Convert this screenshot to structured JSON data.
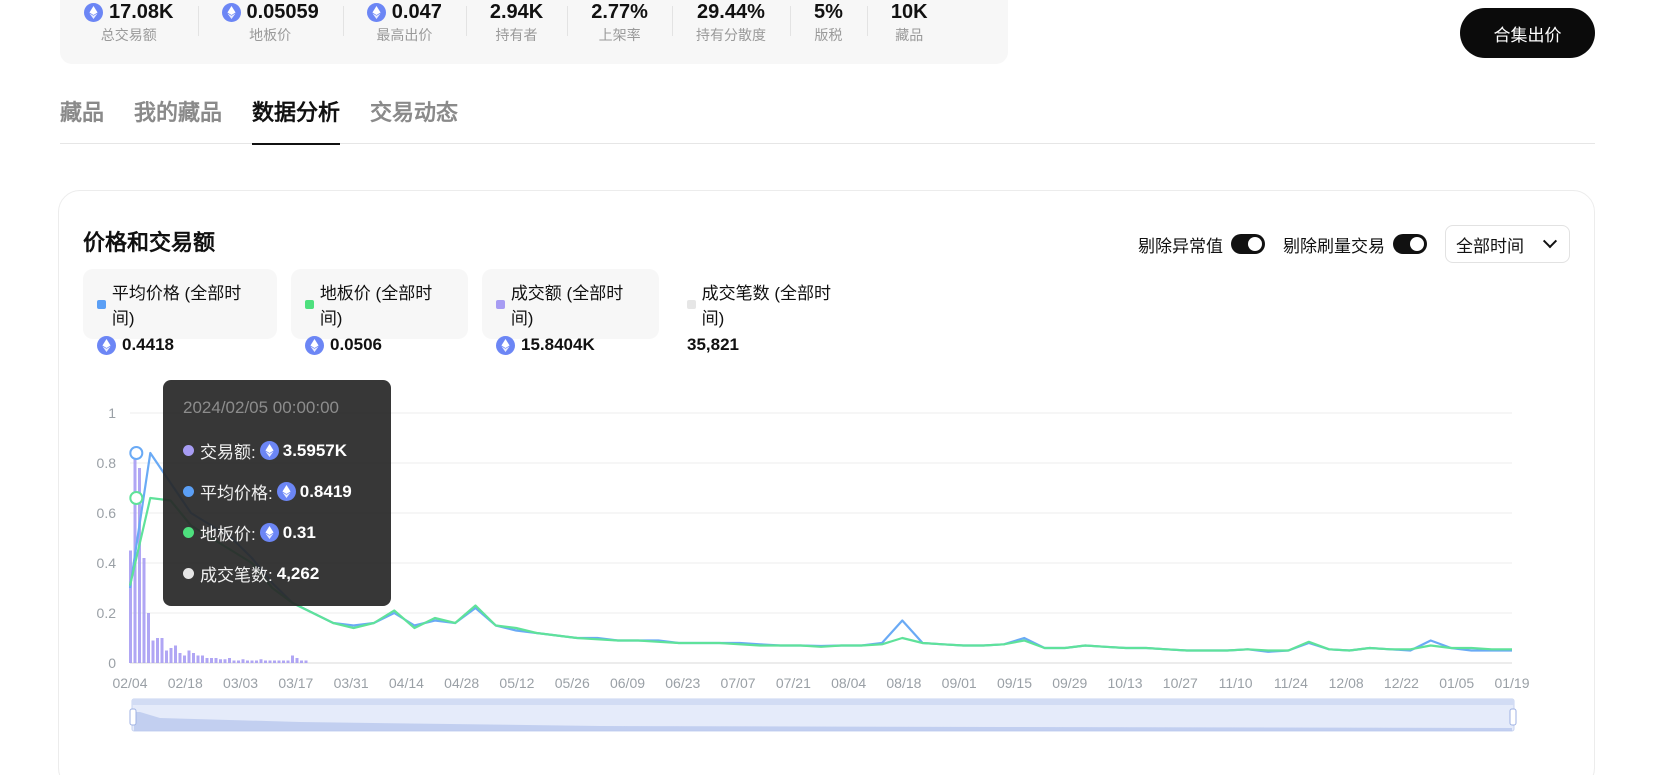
{
  "stats": [
    {
      "value": "17.08K",
      "label": "总交易额",
      "eth": true
    },
    {
      "value": "0.05059",
      "label": "地板价",
      "eth": true
    },
    {
      "value": "0.047",
      "label": "最高出价",
      "eth": true
    },
    {
      "value": "2.94K",
      "label": "持有者",
      "eth": false
    },
    {
      "value": "2.77%",
      "label": "上架率",
      "eth": false
    },
    {
      "value": "29.44%",
      "label": "持有分散度",
      "eth": false
    },
    {
      "value": "5%",
      "label": "版税",
      "eth": false
    },
    {
      "value": "10K",
      "label": "藏品",
      "eth": false
    }
  ],
  "offer_button": "合集出价",
  "tabs": [
    "藏品",
    "我的藏品",
    "数据分析",
    "交易动态"
  ],
  "active_tab": 2,
  "card": {
    "title": "价格和交易额",
    "toggle_outliers": "剔除异常值",
    "toggle_wash": "剔除刷量交易",
    "time_select": "全部时间"
  },
  "legend": [
    {
      "name": "平均价格 (全部时间)",
      "value": "0.4418",
      "color": "#5b9ff5",
      "eth": true
    },
    {
      "name": "地板价 (全部时间)",
      "value": "0.0506",
      "color": "#4ee07e",
      "eth": true
    },
    {
      "name": "成交额 (全部时间)",
      "value": "15.8404K",
      "color": "#a79cf3",
      "eth": true
    },
    {
      "name": "成交笔数 (全部时间)",
      "value": "35,821",
      "color": "#e6e6e6",
      "eth": false
    }
  ],
  "tooltip": {
    "time": "2024/02/05 00:00:00",
    "rows": [
      {
        "label": "交易额:",
        "value": "3.5957K",
        "color": "#a79cf3",
        "eth": true
      },
      {
        "label": "平均价格:",
        "value": "0.8419",
        "color": "#5b9ff5",
        "eth": true
      },
      {
        "label": "地板价:",
        "value": "0.31",
        "color": "#4ee07e",
        "eth": true
      },
      {
        "label": "成交笔数:",
        "value": "4,262",
        "color": "#e6e6e6",
        "eth": false
      }
    ]
  },
  "chart_data": {
    "type": "line",
    "x_categories": [
      "02/04",
      "02/18",
      "03/03",
      "03/17",
      "03/31",
      "04/14",
      "04/28",
      "05/12",
      "05/26",
      "06/09",
      "06/23",
      "07/07",
      "07/21",
      "08/04",
      "08/18",
      "09/01",
      "09/15",
      "09/29",
      "10/13",
      "10/27",
      "11/10",
      "11/24",
      "12/08",
      "12/22",
      "01/05",
      "01/19"
    ],
    "yticks": [
      "0",
      "0.2",
      "0.4",
      "0.6",
      "0.8",
      "1"
    ],
    "ylim": [
      0,
      1
    ],
    "series": [
      {
        "name": "平均价格",
        "color": "#6aaaf5",
        "values": [
          0.3,
          0.84,
          0.72,
          0.6,
          0.55,
          0.5,
          0.42,
          0.32,
          0.24,
          0.2,
          0.16,
          0.15,
          0.16,
          0.2,
          0.15,
          0.17,
          0.16,
          0.22,
          0.15,
          0.13,
          0.12,
          0.11,
          0.1,
          0.1,
          0.09,
          0.09,
          0.09,
          0.08,
          0.08,
          0.08,
          0.08,
          0.075,
          0.07,
          0.07,
          0.068,
          0.07,
          0.07,
          0.08,
          0.17,
          0.08,
          0.075,
          0.07,
          0.07,
          0.075,
          0.1,
          0.06,
          0.06,
          0.07,
          0.065,
          0.06,
          0.06,
          0.055,
          0.05,
          0.05,
          0.05,
          0.055,
          0.045,
          0.05,
          0.08,
          0.055,
          0.05,
          0.06,
          0.055,
          0.05,
          0.09,
          0.06,
          0.05,
          0.05,
          0.05
        ]
      },
      {
        "name": "地板价",
        "color": "#5fe29a",
        "values": [
          0.31,
          0.66,
          0.65,
          0.55,
          0.5,
          0.45,
          0.4,
          0.3,
          0.24,
          0.2,
          0.16,
          0.14,
          0.16,
          0.21,
          0.14,
          0.18,
          0.16,
          0.23,
          0.15,
          0.14,
          0.12,
          0.11,
          0.1,
          0.095,
          0.09,
          0.09,
          0.085,
          0.08,
          0.08,
          0.08,
          0.075,
          0.07,
          0.07,
          0.07,
          0.065,
          0.07,
          0.07,
          0.075,
          0.1,
          0.08,
          0.075,
          0.07,
          0.07,
          0.075,
          0.09,
          0.06,
          0.06,
          0.07,
          0.065,
          0.06,
          0.06,
          0.055,
          0.05,
          0.05,
          0.05,
          0.055,
          0.05,
          0.05,
          0.085,
          0.055,
          0.05,
          0.06,
          0.055,
          0.055,
          0.07,
          0.06,
          0.06,
          0.055,
          0.055
        ]
      },
      {
        "name": "交易额",
        "color": "#a79cf3",
        "values": [
          0.45,
          0.85,
          0.78,
          0.42,
          0.2,
          0.09,
          0.1,
          0.1,
          0.05,
          0.06,
          0.07,
          0.04,
          0.03,
          0.05,
          0.04,
          0.03,
          0.03,
          0.02,
          0.02,
          0.02,
          0.015,
          0.015,
          0.02,
          0.01,
          0.01,
          0.015,
          0.01,
          0.01,
          0.01,
          0.015,
          0.01,
          0.01,
          0.01,
          0.01,
          0.01,
          0.01,
          0.03,
          0.02,
          0.01,
          0.01
        ]
      }
    ],
    "highlight_index": 1,
    "highlight_label": "2024/02/05 00:00:00",
    "grid": true
  }
}
